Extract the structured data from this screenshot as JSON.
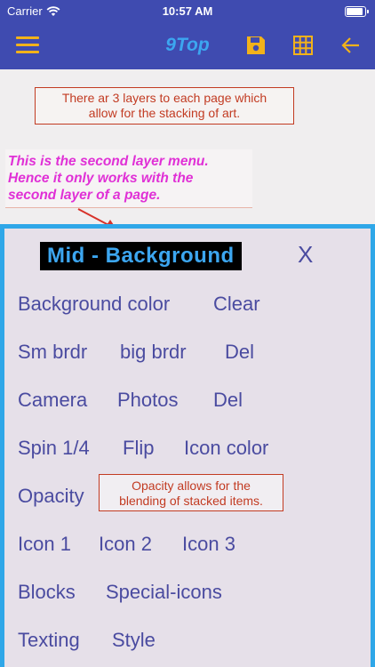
{
  "status_bar": {
    "carrier": "Carrier",
    "time": "10:57 AM"
  },
  "nav": {
    "title": "9Top",
    "icons": [
      "menu-icon",
      "save-icon",
      "grid-icon",
      "back-arrow-icon"
    ],
    "accent": "#f2b21a",
    "bar_color": "#3f4bb0"
  },
  "callouts": {
    "top": [
      "There ar 3 layers to each page which",
      "allow for the stacking of art."
    ],
    "note": [
      "This is the second layer menu.",
      "Hence it only works with the",
      "second layer of a page."
    ],
    "opacity": [
      "Opacity allows for the",
      "blending of stacked items."
    ]
  },
  "panel": {
    "title": "Mid - Background",
    "close_label": "X",
    "rows": [
      [
        "Background color",
        "Clear"
      ],
      [
        "Sm brdr",
        "big brdr",
        "Del"
      ],
      [
        "Camera",
        "Photos",
        "Del"
      ],
      [
        "Spin 1/4",
        "Flip",
        "Icon color"
      ],
      [
        "Opacity"
      ],
      [
        "Icon 1",
        "Icon 2",
        "Icon 3"
      ],
      [
        "Blocks",
        "Special-icons"
      ],
      [
        "Texting",
        "Style"
      ]
    ]
  }
}
